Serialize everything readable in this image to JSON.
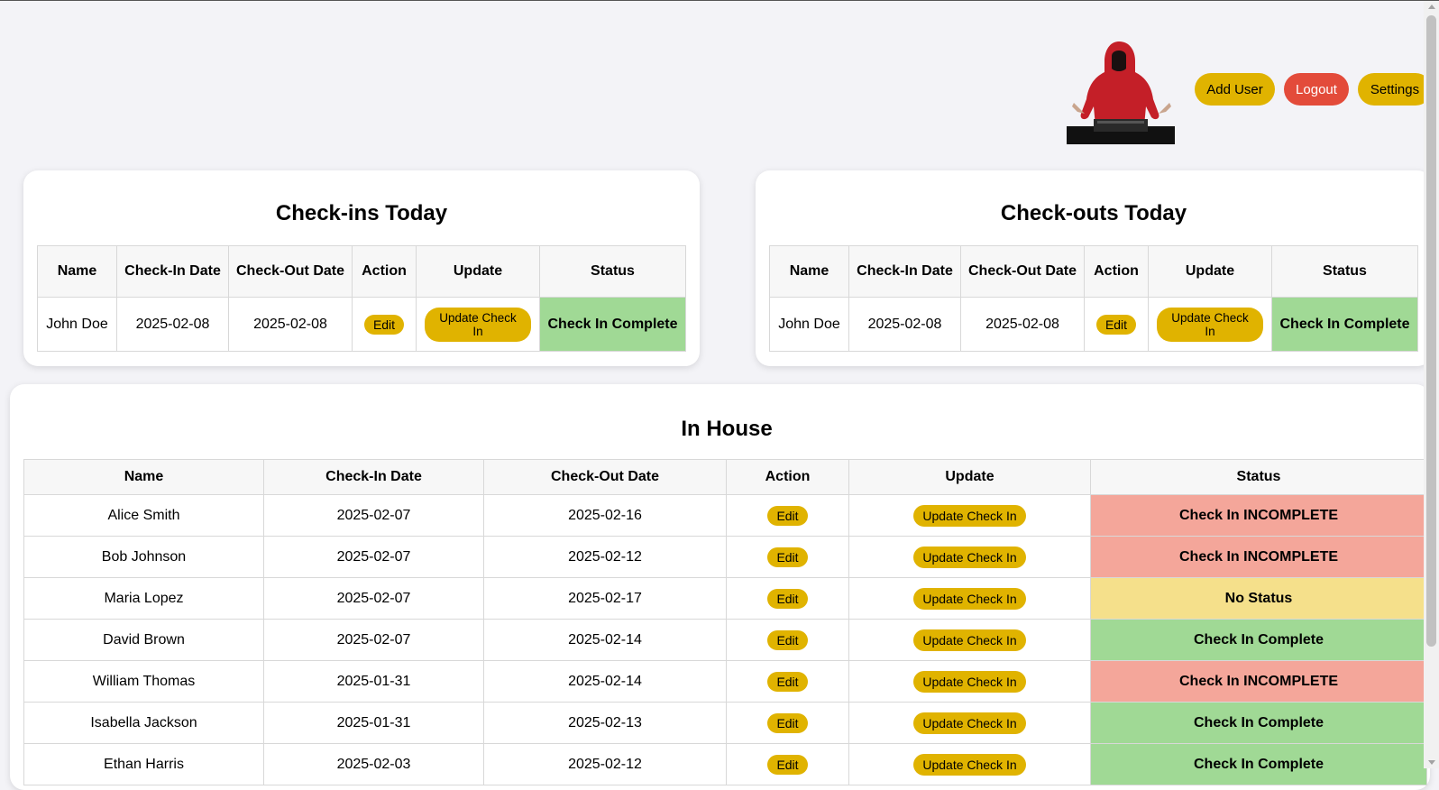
{
  "header": {
    "add_user": "Add User",
    "logout": "Logout",
    "settings": "Settings"
  },
  "checkins": {
    "title": "Check-ins Today",
    "columns": [
      "Name",
      "Check-In Date",
      "Check-Out Date",
      "Action",
      "Update",
      "Status"
    ],
    "row": {
      "name": "John Doe",
      "checkin": "2025-02-08",
      "checkout": "2025-02-08",
      "action": "Edit",
      "update": "Update Check In",
      "status": "Check In Complete"
    }
  },
  "checkouts": {
    "title": "Check-outs Today",
    "columns": [
      "Name",
      "Check-In Date",
      "Check-Out Date",
      "Action",
      "Update",
      "Status"
    ],
    "row": {
      "name": "John Doe",
      "checkin": "2025-02-08",
      "checkout": "2025-02-08",
      "action": "Edit",
      "update": "Update Check In",
      "status": "Check In Complete"
    }
  },
  "inhouse": {
    "title": "In House",
    "columns": [
      "Name",
      "Check-In Date",
      "Check-Out Date",
      "Action",
      "Update",
      "Status"
    ],
    "rows": [
      {
        "name": "Alice Smith",
        "checkin": "2025-02-07",
        "checkout": "2025-02-16",
        "action": "Edit",
        "update": "Update Check In",
        "status": "Check In INCOMPLETE",
        "status_color": "#f4a69a"
      },
      {
        "name": "Bob Johnson",
        "checkin": "2025-02-07",
        "checkout": "2025-02-12",
        "action": "Edit",
        "update": "Update Check In",
        "status": "Check In INCOMPLETE",
        "status_color": "#f4a69a"
      },
      {
        "name": "Maria Lopez",
        "checkin": "2025-02-07",
        "checkout": "2025-02-17",
        "action": "Edit",
        "update": "Update Check In",
        "status": "No Status",
        "status_color": "#f5e08b"
      },
      {
        "name": "David Brown",
        "checkin": "2025-02-07",
        "checkout": "2025-02-14",
        "action": "Edit",
        "update": "Update Check In",
        "status": "Check In Complete",
        "status_color": "#a0d995"
      },
      {
        "name": "William Thomas",
        "checkin": "2025-01-31",
        "checkout": "2025-02-14",
        "action": "Edit",
        "update": "Update Check In",
        "status": "Check In INCOMPLETE",
        "status_color": "#f4a69a"
      },
      {
        "name": "Isabella Jackson",
        "checkin": "2025-01-31",
        "checkout": "2025-02-13",
        "action": "Edit",
        "update": "Update Check In",
        "status": "Check In Complete",
        "status_color": "#a0d995"
      },
      {
        "name": "Ethan Harris",
        "checkin": "2025-02-03",
        "checkout": "2025-02-12",
        "action": "Edit",
        "update": "Update Check In",
        "status": "Check In Complete",
        "status_color": "#a0d995"
      }
    ]
  },
  "colors": {
    "accent_yellow": "#e0b300",
    "logout_red": "#e34b3a",
    "status_complete": "#a0d995",
    "status_incomplete": "#f4a69a",
    "status_none": "#f5e08b"
  }
}
